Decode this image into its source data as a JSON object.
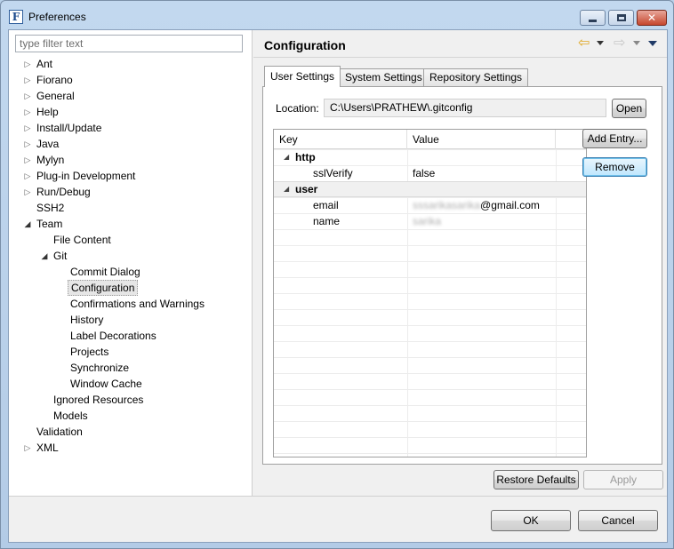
{
  "window": {
    "title": "Preferences",
    "app_icon": "F"
  },
  "left": {
    "filter_placeholder": "type filter text",
    "tree": [
      {
        "label": "Ant",
        "level": 0,
        "twisty": "collapsed"
      },
      {
        "label": "Fiorano",
        "level": 0,
        "twisty": "collapsed"
      },
      {
        "label": "General",
        "level": 0,
        "twisty": "collapsed"
      },
      {
        "label": "Help",
        "level": 0,
        "twisty": "collapsed"
      },
      {
        "label": "Install/Update",
        "level": 0,
        "twisty": "collapsed"
      },
      {
        "label": "Java",
        "level": 0,
        "twisty": "collapsed"
      },
      {
        "label": "Mylyn",
        "level": 0,
        "twisty": "collapsed"
      },
      {
        "label": "Plug-in Development",
        "level": 0,
        "twisty": "collapsed"
      },
      {
        "label": "Run/Debug",
        "level": 0,
        "twisty": "collapsed"
      },
      {
        "label": "SSH2",
        "level": 0,
        "twisty": "none"
      },
      {
        "label": "Team",
        "level": 0,
        "twisty": "expanded"
      },
      {
        "label": "File Content",
        "level": 1,
        "twisty": "none"
      },
      {
        "label": "Git",
        "level": 1,
        "twisty": "expanded"
      },
      {
        "label": "Commit Dialog",
        "level": 2,
        "twisty": "none"
      },
      {
        "label": "Configuration",
        "level": 2,
        "twisty": "none",
        "selected": true
      },
      {
        "label": "Confirmations and Warnings",
        "level": 2,
        "twisty": "none"
      },
      {
        "label": "History",
        "level": 2,
        "twisty": "none"
      },
      {
        "label": "Label Decorations",
        "level": 2,
        "twisty": "none"
      },
      {
        "label": "Projects",
        "level": 2,
        "twisty": "none"
      },
      {
        "label": "Synchronize",
        "level": 2,
        "twisty": "none"
      },
      {
        "label": "Window Cache",
        "level": 2,
        "twisty": "none"
      },
      {
        "label": "Ignored Resources",
        "level": 1,
        "twisty": "none"
      },
      {
        "label": "Models",
        "level": 1,
        "twisty": "none"
      },
      {
        "label": "Validation",
        "level": 0,
        "twisty": "none"
      },
      {
        "label": "XML",
        "level": 0,
        "twisty": "collapsed"
      }
    ]
  },
  "right": {
    "page_title": "Configuration",
    "tabs": [
      {
        "label": "User Settings",
        "active": true
      },
      {
        "label": "System Settings",
        "active": false
      },
      {
        "label": "Repository Settings",
        "active": false
      }
    ],
    "location_label": "Location:",
    "location_value": "C:\\Users\\PRATHEW\\.gitconfig",
    "open_label": "Open",
    "grid": {
      "headers": [
        "Key",
        "Value"
      ],
      "rows": [
        {
          "key": "http",
          "value": "",
          "section": true,
          "selected": false
        },
        {
          "key": "sslVerify",
          "value": "false",
          "section": false,
          "selected": false
        },
        {
          "key": "user",
          "value": "",
          "section": true,
          "selected": true
        },
        {
          "key": "email",
          "value_blur": "sssarikasarika",
          "value": "@gmail.com",
          "section": false,
          "selected": false
        },
        {
          "key": "name",
          "value_blur": "sarika",
          "value": "",
          "section": false,
          "selected": false
        }
      ]
    },
    "add_entry_label": "Add Entry...",
    "remove_label": "Remove",
    "restore_defaults_label": "Restore Defaults",
    "apply_label": "Apply"
  },
  "footer": {
    "ok_label": "OK",
    "cancel_label": "Cancel"
  },
  "colors": {
    "accent_arrow": "#e0a722",
    "close_button": "#c6472e"
  },
  "icons": [
    "back-arrow-icon",
    "forward-arrow-icon",
    "view-menu-icon",
    "chevron-down-icon",
    "close-icon",
    "minimize-icon",
    "maximize-icon"
  ]
}
